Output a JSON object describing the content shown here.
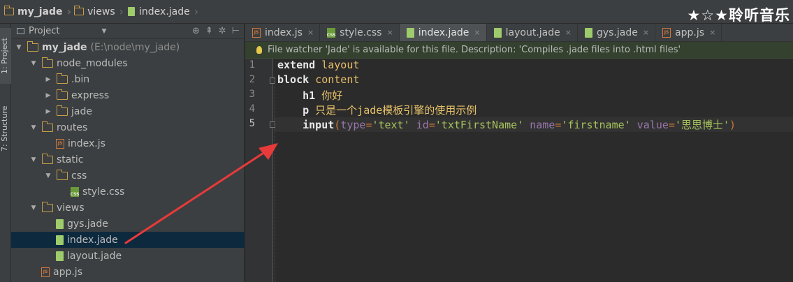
{
  "breadcrumb": {
    "items": [
      {
        "label": "my_jade",
        "kind": "folder"
      },
      {
        "label": "views",
        "kind": "folder"
      },
      {
        "label": "index.jade",
        "kind": "jade-file"
      }
    ]
  },
  "watermark": "★☆★聆听音乐",
  "toolstrip": {
    "project_tab": "1: Project",
    "structure_tab": "7: Structure"
  },
  "project_panel": {
    "header_label": "Project",
    "header_icons": [
      "target-icon",
      "collapse-icon",
      "gear-icon",
      "pin-icon"
    ],
    "tree": [
      {
        "label": "my_jade",
        "path": "(E:\\node\\my_jade)",
        "icon": "folder-icon",
        "expanded": true,
        "depth": 0
      },
      {
        "label": "node_modules",
        "icon": "folder-icon",
        "expanded": true,
        "depth": 1
      },
      {
        "label": ".bin",
        "icon": "folder-icon",
        "expanded": false,
        "depth": 2
      },
      {
        "label": "express",
        "icon": "folder-icon",
        "expanded": false,
        "depth": 2
      },
      {
        "label": "jade",
        "icon": "folder-icon",
        "expanded": false,
        "depth": 2
      },
      {
        "label": "routes",
        "icon": "folder-icon",
        "expanded": true,
        "depth": 1
      },
      {
        "label": "index.js",
        "icon": "js-file-icon",
        "depth": 2
      },
      {
        "label": "static",
        "icon": "folder-icon",
        "expanded": true,
        "depth": 1
      },
      {
        "label": "css",
        "icon": "folder-icon",
        "expanded": true,
        "depth": 2
      },
      {
        "label": "style.css",
        "icon": "css-file-icon",
        "depth": 3
      },
      {
        "label": "views",
        "icon": "folder-icon",
        "expanded": true,
        "depth": 1
      },
      {
        "label": "gys.jade",
        "icon": "jade-file-icon",
        "depth": 2
      },
      {
        "label": "index.jade",
        "icon": "jade-file-icon",
        "depth": 2,
        "selected": true
      },
      {
        "label": "layout.jade",
        "icon": "jade-file-icon",
        "depth": 2
      },
      {
        "label": "app.js",
        "icon": "js-file-icon",
        "depth": 1
      }
    ]
  },
  "editor": {
    "tabs": [
      {
        "label": "index.js",
        "icon": "js-file-icon"
      },
      {
        "label": "style.css",
        "icon": "css-file-icon"
      },
      {
        "label": "index.jade",
        "icon": "jade-file-icon",
        "active": true
      },
      {
        "label": "layout.jade",
        "icon": "jade-file-icon"
      },
      {
        "label": "gys.jade",
        "icon": "jade-file-icon"
      },
      {
        "label": "app.js",
        "icon": "js-file-icon"
      }
    ],
    "close_glyph": "×",
    "notice": "File watcher 'Jade' is available for this file. Description: 'Compiles .jade files into .html files'",
    "current_line": 5,
    "lines": [
      {
        "num": "1",
        "tokens": [
          {
            "t": "extend",
            "c": "kw"
          },
          {
            "t": " ",
            "c": ""
          },
          {
            "t": "layout",
            "c": "tag"
          }
        ]
      },
      {
        "num": "2",
        "tokens": [
          {
            "t": "block",
            "c": "kw"
          },
          {
            "t": " ",
            "c": ""
          },
          {
            "t": "content",
            "c": "tag"
          }
        ]
      },
      {
        "num": "3",
        "tokens": [
          {
            "t": "    ",
            "c": ""
          },
          {
            "t": "h1",
            "c": "kw"
          },
          {
            "t": " 你好",
            "c": "txt"
          }
        ]
      },
      {
        "num": "4",
        "tokens": [
          {
            "t": "    ",
            "c": ""
          },
          {
            "t": "p",
            "c": "kw"
          },
          {
            "t": " 只是一个jade模板引擎的使用示例",
            "c": "txt"
          }
        ]
      },
      {
        "num": "5",
        "tokens": [
          {
            "t": "    ",
            "c": ""
          },
          {
            "t": "input",
            "c": "kw"
          },
          {
            "t": "(",
            "c": "punct"
          },
          {
            "t": "type",
            "c": "attr"
          },
          {
            "t": "=",
            "c": "punct"
          },
          {
            "t": "'text'",
            "c": "str"
          },
          {
            "t": " ",
            "c": ""
          },
          {
            "t": "id",
            "c": "attr"
          },
          {
            "t": "=",
            "c": "punct"
          },
          {
            "t": "'txtFirstName'",
            "c": "str"
          },
          {
            "t": " ",
            "c": ""
          },
          {
            "t": "name",
            "c": "attr"
          },
          {
            "t": "=",
            "c": "punct"
          },
          {
            "t": "'firstname'",
            "c": "str"
          },
          {
            "t": " ",
            "c": ""
          },
          {
            "t": "value",
            "c": "attr"
          },
          {
            "t": "=",
            "c": "punct"
          },
          {
            "t": "'思思博士'",
            "c": "str"
          },
          {
            "t": ")",
            "c": "punct"
          }
        ]
      }
    ]
  },
  "colors": {
    "annotation_arrow": "#e83a3a",
    "selection": "#0d293e",
    "folder": "#c79d4a",
    "jade_file": "#9ecb6c"
  }
}
